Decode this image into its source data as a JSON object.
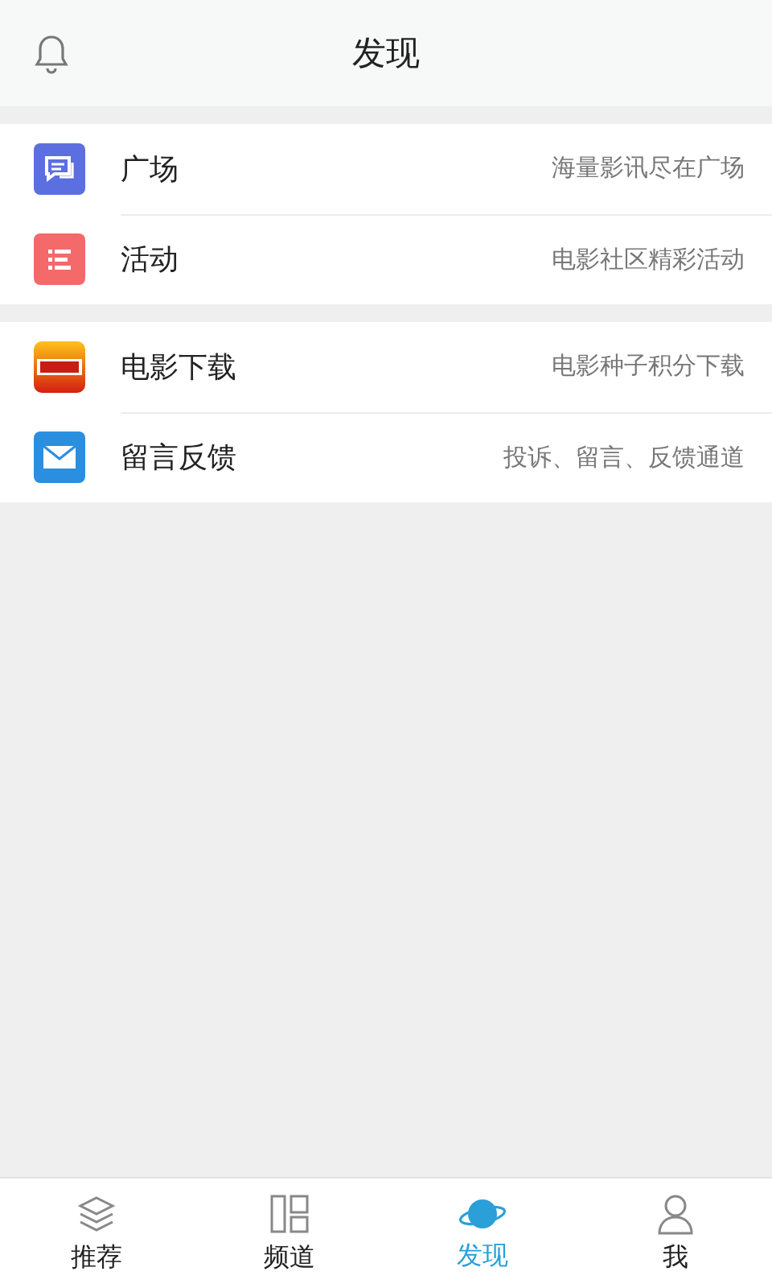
{
  "header": {
    "title": "发现"
  },
  "sections": [
    {
      "items": [
        {
          "kind": "chat",
          "label": "广场",
          "hint": "海量影讯尽在广场"
        },
        {
          "kind": "list",
          "label": "活动",
          "hint": "电影社区精彩活动"
        }
      ]
    },
    {
      "items": [
        {
          "kind": "film",
          "label": "电影下载",
          "hint": "电影种子积分下载"
        },
        {
          "kind": "mail",
          "label": "留言反馈",
          "hint": "投诉、留言、反馈通道"
        }
      ]
    }
  ],
  "tabs": [
    {
      "kind": "layers",
      "label": "推荐",
      "selected": false
    },
    {
      "kind": "panels",
      "label": "频道",
      "selected": false
    },
    {
      "kind": "planet",
      "label": "发现",
      "selected": true
    },
    {
      "kind": "person",
      "label": "我",
      "selected": false
    }
  ]
}
